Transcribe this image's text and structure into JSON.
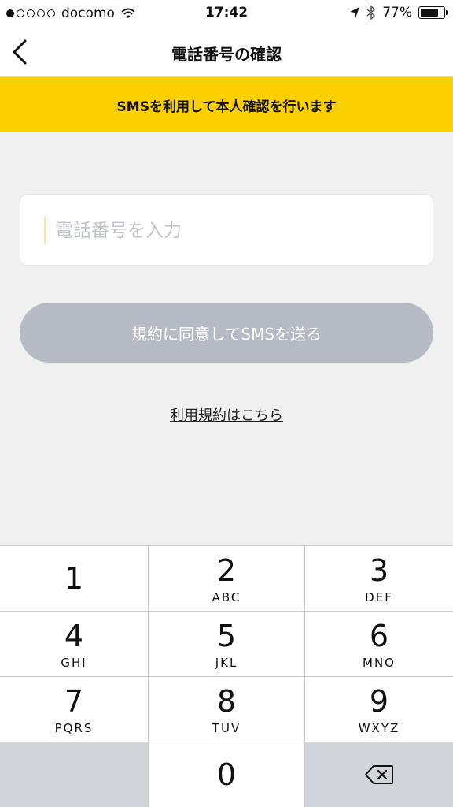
{
  "status_bar": {
    "carrier": "docomo",
    "time": "17:42",
    "battery": "77%",
    "signal_bars_filled": 1,
    "signal_bars_total": 5
  },
  "nav": {
    "title": "電話番号の確認",
    "back_icon": "chevron-left-icon"
  },
  "banner": {
    "text": "SMSを利用して本人確認を行います",
    "color": "#fccf00"
  },
  "phone_input": {
    "placeholder": "電話番号を入力",
    "value": ""
  },
  "send_button": {
    "label": "規約に同意してSMSを送る"
  },
  "terms_link": {
    "label": "利用規約はこちら"
  },
  "keypad": {
    "keys": [
      {
        "digit": "1",
        "letters": ""
      },
      {
        "digit": "2",
        "letters": "ABC"
      },
      {
        "digit": "3",
        "letters": "DEF"
      },
      {
        "digit": "4",
        "letters": "GHI"
      },
      {
        "digit": "5",
        "letters": "JKL"
      },
      {
        "digit": "6",
        "letters": "MNO"
      },
      {
        "digit": "7",
        "letters": "PQRS"
      },
      {
        "digit": "8",
        "letters": "TUV"
      },
      {
        "digit": "9",
        "letters": "WXYZ"
      },
      {
        "digit": "0",
        "letters": ""
      }
    ],
    "delete_icon": "backspace-icon"
  }
}
